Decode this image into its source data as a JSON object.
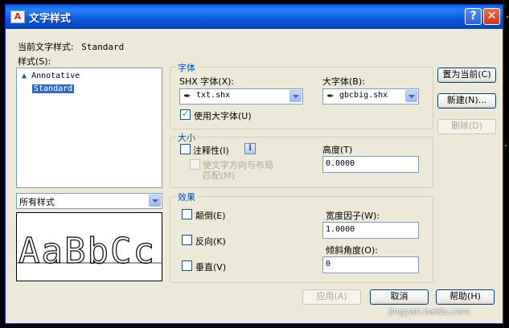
{
  "window": {
    "title": "文字样式",
    "help_label": "?",
    "close_label": "✕"
  },
  "current_style": {
    "label": "当前文字样式:",
    "value": "Standard"
  },
  "styles": {
    "label": "样式(S):",
    "items": [
      {
        "name": "Annotative",
        "icon": "annotative-icon"
      },
      {
        "name": "Standard",
        "selected": true
      }
    ]
  },
  "filter": {
    "selected": "所有样式"
  },
  "preview": {
    "text": "AaBbCc"
  },
  "font_group": {
    "title": "字体",
    "shx_label": "SHX 字体(X):",
    "shx_value": "txt.shx",
    "big_label": "大字体(B):",
    "big_value": "gbcbig.shx",
    "use_big_label": "使用大字体(U)",
    "use_big_checked": true
  },
  "size_group": {
    "title": "大小",
    "annotative_label": "注释性(I)",
    "annotative_checked": false,
    "match_label_line1": "使文字方向与布局",
    "match_label_line2": "匹配(M)",
    "height_label": "高度(T)",
    "height_value": "0.0000"
  },
  "effects_group": {
    "title": "效果",
    "upside_down_label": "颠倒(E)",
    "backwards_label": "反向(K)",
    "vertical_label": "垂直(V)",
    "width_label": "宽度因子(W):",
    "width_value": "1.0000",
    "oblique_label": "倾斜角度(O):",
    "oblique_value": "0"
  },
  "buttons": {
    "set_current": "置为当前(C)",
    "new": "新建(N)...",
    "delete": "删除(D)",
    "apply": "应用(A)",
    "cancel": "取消",
    "help": "帮助(H)"
  },
  "watermark": {
    "site": "jingyan.baidu.com"
  },
  "colors": {
    "title_bar": "#0a5fe0",
    "dialog_bg": "#ece9d8",
    "group_title": "#0046d5",
    "selection": "#316ac5",
    "cad_line": "#3fae2f"
  }
}
